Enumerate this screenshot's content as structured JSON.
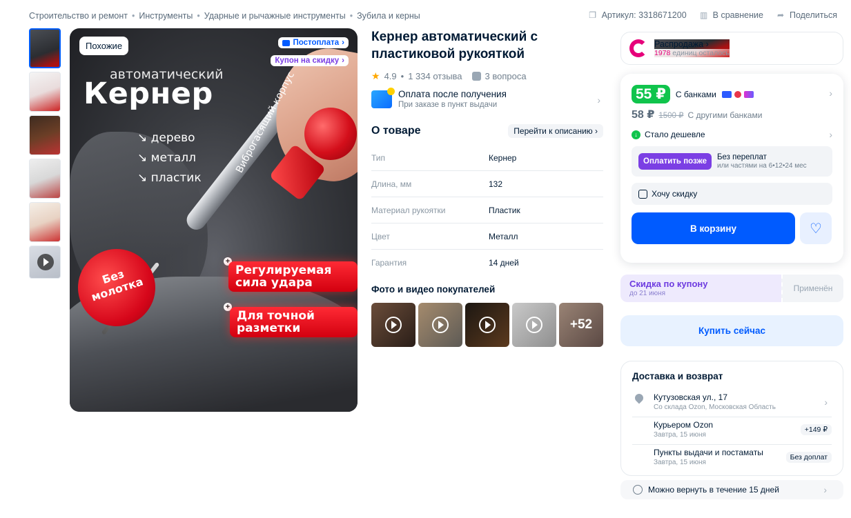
{
  "breadcrumbs": [
    "Строительство и ремонт",
    "Инструменты",
    "Ударные и рычажные инструменты",
    "Зубила и керны"
  ],
  "meta": {
    "article": "Артикул: 3318671200",
    "compare": "В сравнение",
    "share": "Поделиться"
  },
  "hero": {
    "similar_badge": "Похожие",
    "postpay_pill": "Постоплата",
    "coupon_pill": "Купон на скидку",
    "subtitle": "автоматический",
    "big_title": "Кернер",
    "materials": [
      "дерево",
      "металл",
      "пластик"
    ],
    "vertical_text": "Виброгасящий корпус",
    "circle_text": "Без молотка",
    "tag_a": "Регулируемая сила удара",
    "tag_b": "Для точной разметки"
  },
  "product": {
    "title": "Кернер автоматический с пластиковой рукояткой",
    "rating": "4.9",
    "reviews": "1 334 отзыва",
    "questions": "3 вопроса",
    "pay_after": "Оплата после получения",
    "pay_after_sub": "При заказе в пункт выдачи",
    "about_title": "О товаре",
    "about_link": "Перейти к описанию",
    "specs": [
      {
        "k": "Тип",
        "v": "Кернер"
      },
      {
        "k": "Длина, мм",
        "v": "132"
      },
      {
        "k": "Материал рукоятки",
        "v": "Пластик"
      },
      {
        "k": "Цвет",
        "v": "Металл"
      },
      {
        "k": "Гарантия",
        "v": "14 дней"
      }
    ],
    "photos_title": "Фото и видео покупателей",
    "photos_more": "+52"
  },
  "sale": {
    "title": "Распродажа",
    "count": "1978",
    "count_text": "единиц осталось",
    "accent": "#e6007a"
  },
  "price": {
    "bank_price": "55 ₽",
    "bank_label": "С банками",
    "other_price": "58 ₽",
    "old_price": "1500 ₽",
    "other_label": "С другими банками",
    "cheaper": "Стало дешевле",
    "paylater_btn": "Оплатить позже",
    "paylater_a": "Без переплат",
    "paylater_b": "или частями на 6•12•24 мес",
    "want_discount": "Хочу скидку",
    "cart": "В корзину",
    "green": "#10c44c",
    "blue": "#005bff"
  },
  "coupon": {
    "title": "Скидка по купону",
    "until": "до 21 июня",
    "status": "Применён"
  },
  "buy_now": "Купить сейчас",
  "delivery": {
    "title": "Доставка и возврат",
    "address": "Кутузовская ул., 17",
    "address_sub": "Со склада Ozon, Московская Область",
    "courier": "Курьером Ozon",
    "courier_date": "Завтра, 15 июня",
    "courier_price": "+149 ₽",
    "points": "Пункты выдачи и постаматы",
    "points_date": "Завтра, 15 июня",
    "points_price": "Без доплат",
    "return": "Можно вернуть в течение 15 дней"
  }
}
